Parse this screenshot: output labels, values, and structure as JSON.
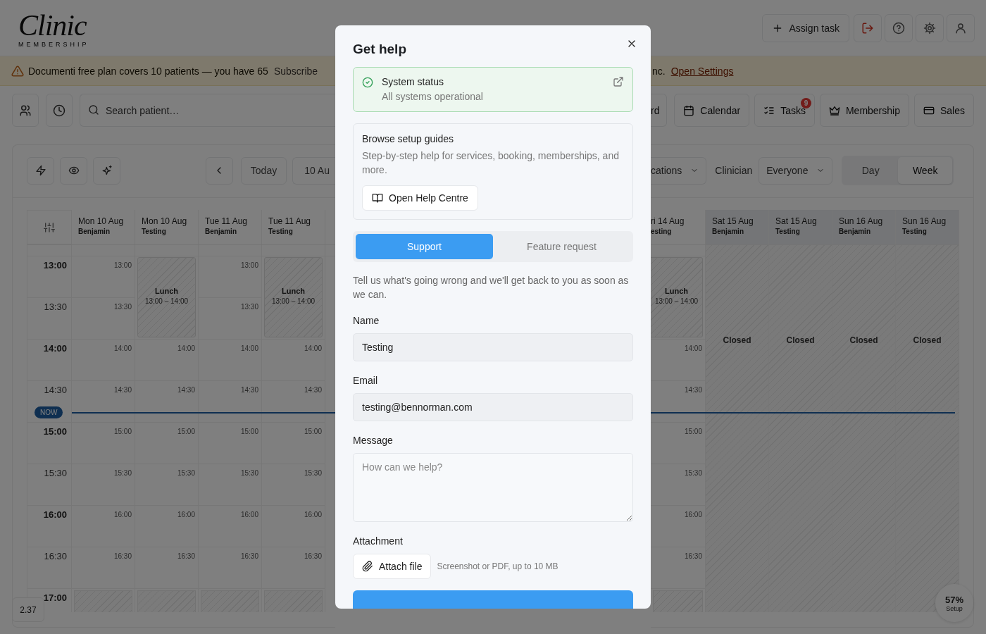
{
  "header": {
    "logo": {
      "wordmark": "Clinic",
      "tagline": "MEMBERSHIP"
    },
    "actions": [
      {
        "kind": "assign",
        "label": "Assign task"
      },
      {
        "kind": "logout"
      },
      {
        "kind": "help"
      },
      {
        "kind": "settings"
      },
      {
        "kind": "account"
      }
    ]
  },
  "banner": {
    "message": "Documenti free plan covers 10 patients — you have 65",
    "subscribe": "Subscribe",
    "message_end": "nc.",
    "link": "Open Settings"
  },
  "nav": {
    "shortcuts": [
      {
        "kind": "patients"
      },
      {
        "kind": "history"
      }
    ],
    "search": {
      "placeholder": "Search patient…"
    },
    "tabs": [
      {
        "label": "rd",
        "selected": false
      },
      {
        "label": "Calendar",
        "selected": false
      },
      {
        "label": "Tasks",
        "badge": "9",
        "selected": false
      },
      {
        "label": "Membership",
        "selected": false
      },
      {
        "label": "Sales",
        "selected": false
      }
    ]
  },
  "calendar": {
    "tools": [
      {
        "kind": "quick"
      },
      {
        "kind": "view"
      },
      {
        "kind": "ai"
      }
    ],
    "today": "Today",
    "range": "10 Au",
    "location": "cations",
    "clinician_label": "Clinician",
    "clinician": "Everyone",
    "views": [
      {
        "label": "Day",
        "selected": false
      },
      {
        "label": "Week",
        "selected": true
      }
    ],
    "now_label": "NOW",
    "times": [
      {
        "label": "13:00",
        "major": true
      },
      {
        "label": "13:30",
        "major": false
      },
      {
        "label": "14:00",
        "major": true
      },
      {
        "label": "14:30",
        "major": false
      },
      {
        "label": "15:00",
        "major": true
      },
      {
        "label": "15:30",
        "major": false
      },
      {
        "label": "16:00",
        "major": true
      },
      {
        "label": "16:30",
        "major": false
      },
      {
        "label": "17:00",
        "major": true
      }
    ],
    "left_columns": [
      {
        "day": "Mon 10 Aug",
        "clinician": "Benjamin",
        "closed": false,
        "cells": [
          {
            "kind": "slot",
            "label": "13:00"
          },
          {
            "kind": "slot",
            "label": "13:30"
          },
          {
            "kind": "slot",
            "label": "14:00"
          },
          {
            "kind": "slot",
            "label": "14:30"
          },
          {
            "kind": "slot",
            "label": "15:00"
          },
          {
            "kind": "slot",
            "label": "15:30"
          },
          {
            "kind": "slot",
            "label": "16:00"
          },
          {
            "kind": "slot",
            "label": "16:30"
          },
          {
            "kind": "after_hours"
          }
        ]
      },
      {
        "day": "Mon 10 Aug",
        "clinician": "Testing",
        "closed": false,
        "cells": [
          {
            "kind": "break",
            "title": "Lunch",
            "time": "13:00 – 14:00"
          },
          {
            "kind": "slot",
            "label": "14:00"
          },
          {
            "kind": "slot",
            "label": "14:30"
          },
          {
            "kind": "slot",
            "label": "15:00"
          },
          {
            "kind": "slot",
            "label": "15:30"
          },
          {
            "kind": "slot",
            "label": "16:00"
          },
          {
            "kind": "slot",
            "label": "16:30"
          },
          {
            "kind": "after_hours"
          }
        ]
      },
      {
        "day": "Tue 11 Aug",
        "clinician": "Benjamin",
        "closed": false,
        "cells": [
          {
            "kind": "slot",
            "label": "13:00"
          },
          {
            "kind": "slot",
            "label": "13:30"
          },
          {
            "kind": "slot",
            "label": "14:00"
          },
          {
            "kind": "slot",
            "label": "14:30"
          },
          {
            "kind": "slot",
            "label": "15:00"
          },
          {
            "kind": "slot",
            "label": "15:30"
          },
          {
            "kind": "slot",
            "label": "16:00"
          },
          {
            "kind": "slot",
            "label": "16:30"
          },
          {
            "kind": "after_hours"
          }
        ]
      },
      {
        "day": "Tue 11 Aug",
        "clinician": "Testing",
        "closed": false,
        "cells": [
          {
            "kind": "break",
            "title": "Lunch",
            "time": "13:00 – 14:00"
          },
          {
            "kind": "slot",
            "label": "14:00"
          },
          {
            "kind": "slot",
            "label": "14:30"
          },
          {
            "kind": "slot",
            "label": "15:00"
          },
          {
            "kind": "slot",
            "label": "15:30"
          },
          {
            "kind": "slot",
            "label": "16:00"
          },
          {
            "kind": "slot",
            "label": "16:30"
          },
          {
            "kind": "after_hours"
          }
        ]
      }
    ],
    "right_columns": [
      {
        "day": "ri 14 Aug",
        "clinician": "esting",
        "closed": false,
        "cells": [
          {
            "kind": "break",
            "title": "Lunch",
            "time": "13:00 – 14:00"
          },
          {
            "kind": "slot",
            "label": "14:00"
          },
          {
            "kind": "slot",
            "label": "14:30"
          },
          {
            "kind": "slot",
            "label": "15:00"
          },
          {
            "kind": "slot",
            "label": "15:30"
          },
          {
            "kind": "slot",
            "label": "16:00"
          },
          {
            "kind": "slot",
            "label": "16:30"
          },
          {
            "kind": "after_hours"
          }
        ]
      },
      {
        "day": "Sat 15 Aug",
        "clinician": "Benjamin",
        "closed": true,
        "label": "Closed"
      },
      {
        "day": "Sat 15 Aug",
        "clinician": "Testing",
        "closed": true,
        "label": "Closed"
      },
      {
        "day": "Sun 16 Aug",
        "clinician": "Benjamin",
        "closed": true,
        "label": "Closed"
      },
      {
        "day": "Sun 16 Aug",
        "clinician": "Testing",
        "closed": true,
        "label": "Closed"
      }
    ]
  },
  "footer": {
    "version": "2.37",
    "setup": {
      "percent": "57%",
      "label": "Setup"
    }
  },
  "dialog": {
    "title": "Get help",
    "status": {
      "ok": true,
      "title": "System status",
      "text": "All systems operational"
    },
    "guides": {
      "title": "Browse setup guides",
      "text": "Step-by-step help for services, booking, memberships, and more.",
      "button": "Open Help Centre"
    },
    "tabs": [
      {
        "label": "Support",
        "selected": true
      },
      {
        "label": "Feature request",
        "selected": false
      }
    ],
    "intro": "Tell us what's going wrong and we'll get back to you as soon as we can.",
    "fields": [
      {
        "kind": "input",
        "label": "Name",
        "value": "Testing"
      },
      {
        "kind": "input",
        "label": "Email",
        "value": "testing@bennorman.com"
      },
      {
        "kind": "textarea",
        "label": "Message",
        "placeholder": "How can we help?"
      },
      {
        "kind": "attachment",
        "label": "Attachment",
        "button": "Attach file",
        "hint": "Screenshot or PDF, up to 10 MB"
      }
    ]
  }
}
